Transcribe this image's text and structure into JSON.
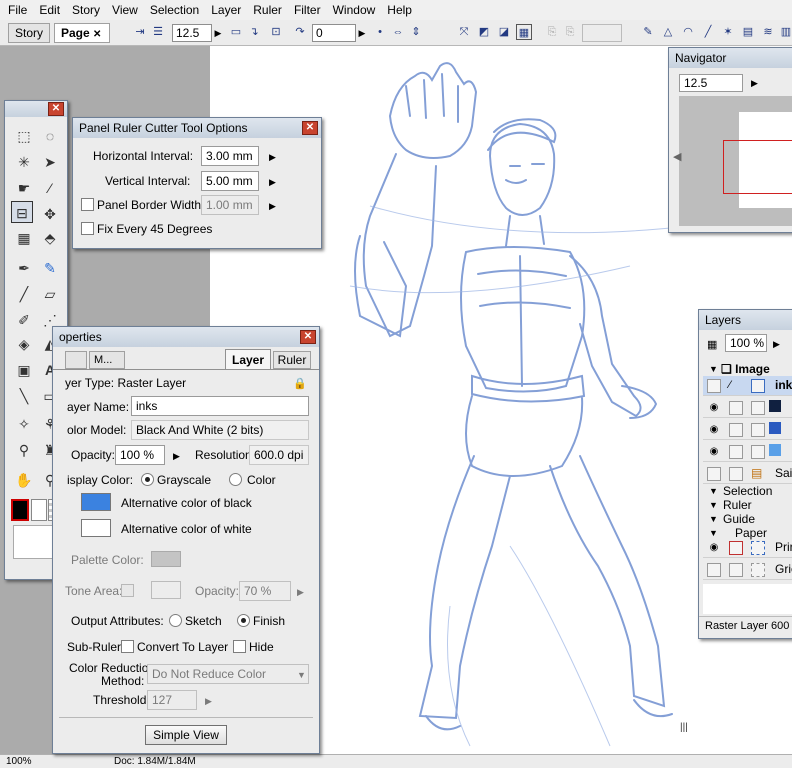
{
  "menu": [
    "File",
    "Edit",
    "Story",
    "View",
    "Selection",
    "Layer",
    "Ruler",
    "Filter",
    "Window",
    "Help"
  ],
  "toolbar": {
    "tabs": [
      {
        "label": "Story"
      },
      {
        "label": "Page"
      }
    ],
    "tab_close": "✕",
    "zoom_value": "12.5",
    "rotation_value": "0"
  },
  "status": {
    "zoom": "100%",
    "doc": "Doc: 1.84M/1.84M"
  },
  "ruler_cutter": {
    "title": "Panel Ruler Cutter Tool Options",
    "h_interval_label": "Horizontal Interval:",
    "h_interval_value": "3.00 mm",
    "v_interval_label": "Vertical Interval:",
    "v_interval_value": "5.00 mm",
    "border_width_label": "Panel Border Width:",
    "border_width_value": "1.00 mm",
    "fix45_label": "Fix Every 45 Degrees"
  },
  "navigator": {
    "title": "Navigator",
    "zoom": "12.5"
  },
  "properties": {
    "title": "operties",
    "tabs": [
      "",
      "M...",
      "Layer",
      "Ruler"
    ],
    "layer_type": "yer Type: Raster Layer",
    "layer_name_label": "ayer Name:",
    "layer_name_value": "inks",
    "color_model_label": "olor Model:",
    "color_model_value": "Black And White (2 bits)",
    "opacity_label": "Opacity:",
    "opacity_value": "100 %",
    "resolution_label": "Resolution:",
    "resolution_value": "600.0 dpi",
    "display_color_label": "isplay Color:",
    "grayscale_label": "Grayscale",
    "color_label": "Color",
    "alt_black_label": "Alternative color of black",
    "alt_white_label": "Alternative color of white",
    "palette_color_label": "Palette Color:",
    "tone_area_label": "Tone Area:",
    "tone_opacity_label": "Opacity:",
    "tone_opacity_value": "70 %",
    "output_label": "Output Attributes:",
    "sketch_label": "Sketch",
    "finish_label": "Finish",
    "subruler_label": "Sub-Ruler:",
    "convert_label": "Convert To Layer",
    "hide_label": "Hide",
    "color_reduction_label1": "Color Reduction",
    "color_reduction_label2": "Method:",
    "color_reduction_value": "Do Not Reduce Color",
    "threshold_label": "Threshold:",
    "threshold_value": "127",
    "simple_view_label": "Simple View"
  },
  "layers": {
    "title": "Layers",
    "opacity": "100 %",
    "image_group": "Image",
    "rows": [
      "ink",
      "",
      "",
      "Sail"
    ],
    "selection": "Selection",
    "ruler": "Ruler",
    "guide": "Guide",
    "paper": "Paper",
    "paper_rows": [
      "Prir",
      "Gric"
    ],
    "status": "Raster Layer 600 d"
  },
  "colors": {
    "accent_blue": "#3b82e0",
    "sketch_blue": "#6f8fd0",
    "layer_highlight": "#c8d8f0"
  }
}
